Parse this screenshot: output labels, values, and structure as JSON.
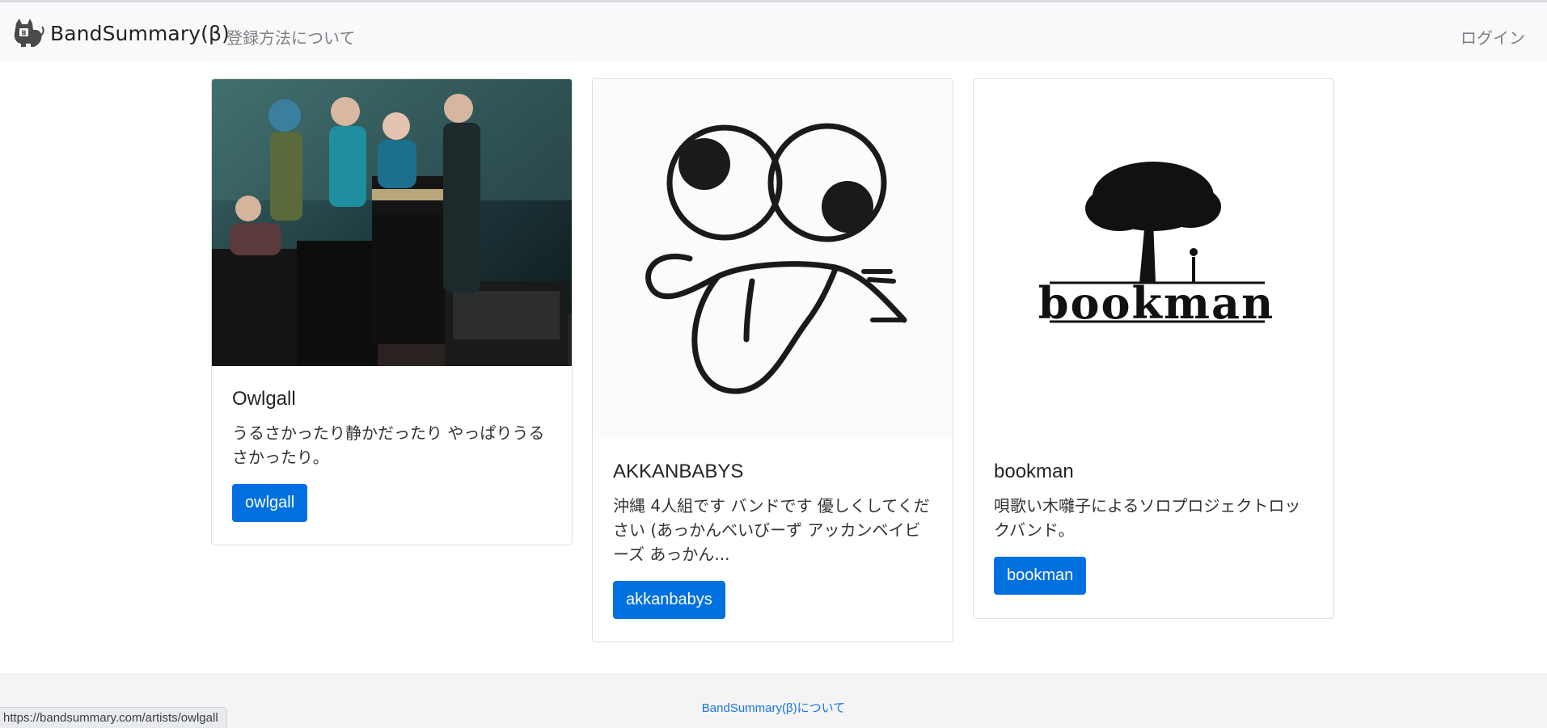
{
  "navbar": {
    "brand": "BandSummary(β)",
    "register_link": "登録方法について",
    "login_link": "ログイン"
  },
  "cards": [
    {
      "title": "Owlgall",
      "description": "うるさかったり静かだったり やっぱりうるさかったり。",
      "button": "owlgall",
      "image": "band-photo"
    },
    {
      "title": "AKKANBABYS",
      "description": "沖縄 4人組です バンドです 優しくしてください (あっかんべいびーず アッカンベイビーズ あっかん...",
      "button": "akkanbabys",
      "image": "googly-eyes-face-logo"
    },
    {
      "title": "bookman",
      "description": "唄歌い木囃子によるソロプロジェクトロックバンド。",
      "button": "bookman",
      "image": "tree-bookman-logo"
    }
  ],
  "footer": {
    "about_link": "BandSummary(β)について"
  },
  "status_bar": {
    "url": "https://bandsummary.com/artists/owlgall"
  },
  "colors": {
    "button": "#0070e0",
    "navbar_bg": "#f8f9fa",
    "footer_bg": "#f4f4f5",
    "footer_link": "#1a73e8"
  }
}
